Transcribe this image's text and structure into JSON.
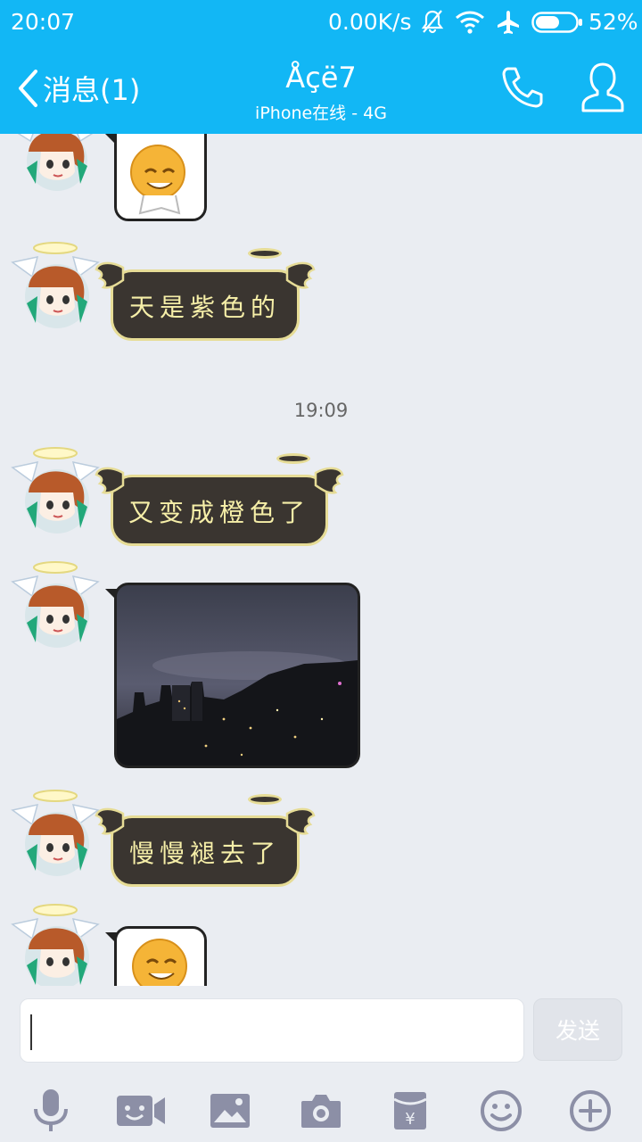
{
  "status_bar": {
    "time": "20:07",
    "net_speed": "0.00K/s",
    "battery_percent": "52%"
  },
  "header": {
    "back_label": "消息(1)",
    "title": "Åçë7",
    "subtitle": "iPhone在线 - 4G",
    "accent_color": "#12b7f5"
  },
  "chat": {
    "messages": [
      {
        "type": "sticker"
      },
      {
        "type": "text",
        "text": "天是紫色的"
      },
      {
        "type": "timestamp",
        "text": "19:09"
      },
      {
        "type": "text",
        "text": "又变成橙色了"
      },
      {
        "type": "photo"
      },
      {
        "type": "text",
        "text": "慢慢褪去了"
      },
      {
        "type": "sticker"
      }
    ]
  },
  "input": {
    "value": "",
    "send_label": "发送"
  },
  "toolbar": {
    "icons": [
      "microphone-icon",
      "video-call-icon",
      "image-icon",
      "camera-icon",
      "red-packet-icon",
      "emoji-icon",
      "plus-icon"
    ]
  }
}
